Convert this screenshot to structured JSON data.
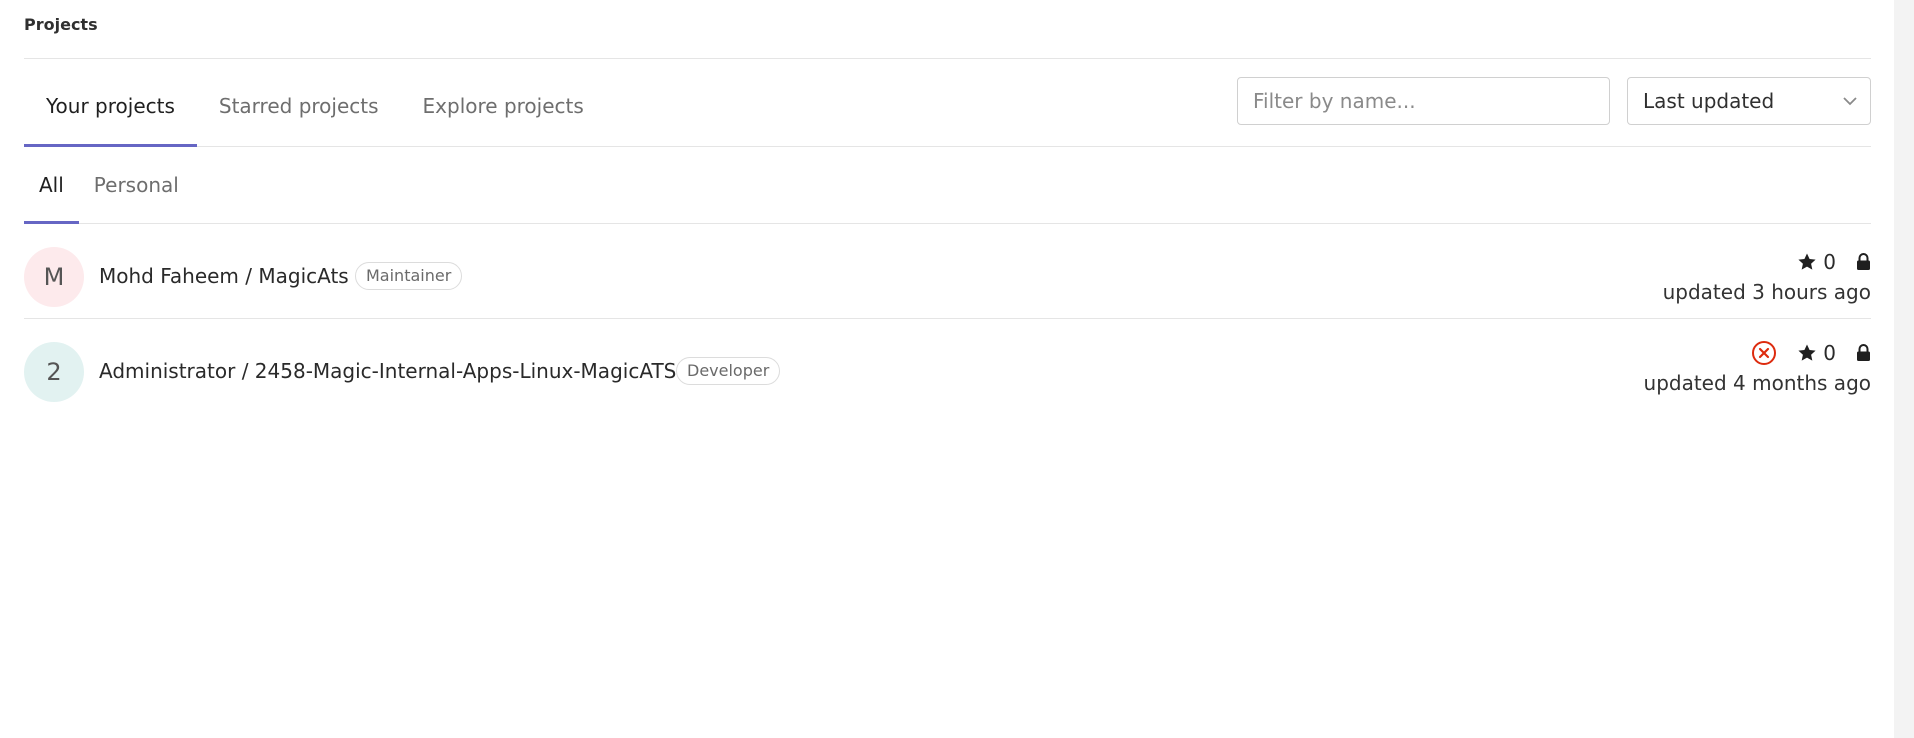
{
  "breadcrumb": {
    "title": "Projects"
  },
  "tabs": [
    {
      "label": "Your projects",
      "active": true
    },
    {
      "label": "Starred projects",
      "active": false
    },
    {
      "label": "Explore projects",
      "active": false
    }
  ],
  "filter": {
    "placeholder": "Filter by name..."
  },
  "sort": {
    "selected": "Last updated",
    "icon": "chevron-down-icon"
  },
  "subtabs": [
    {
      "label": "All",
      "active": true
    },
    {
      "label": "Personal",
      "active": false
    }
  ],
  "projects": [
    {
      "avatar_letter": "M",
      "avatar_color": "#fdeaec",
      "title": "Mohd Faheem / MagicAts",
      "role": "Maintainer",
      "stars": "0",
      "visibility_icon": "lock-icon",
      "pipeline_status": null,
      "updated": "updated 3 hours ago"
    },
    {
      "avatar_letter": "2",
      "avatar_color": "#e2f2f1",
      "title": "Administrator / 2458-Magic-Internal-Apps-Linux-MagicATS",
      "role": "Developer",
      "stars": "0",
      "visibility_icon": "lock-icon",
      "pipeline_status": "failed",
      "updated": "updated 4 months ago"
    }
  ],
  "colors": {
    "accent": "#6666c4",
    "failed": "#dd2b0e",
    "border": "#e5e5e5"
  }
}
